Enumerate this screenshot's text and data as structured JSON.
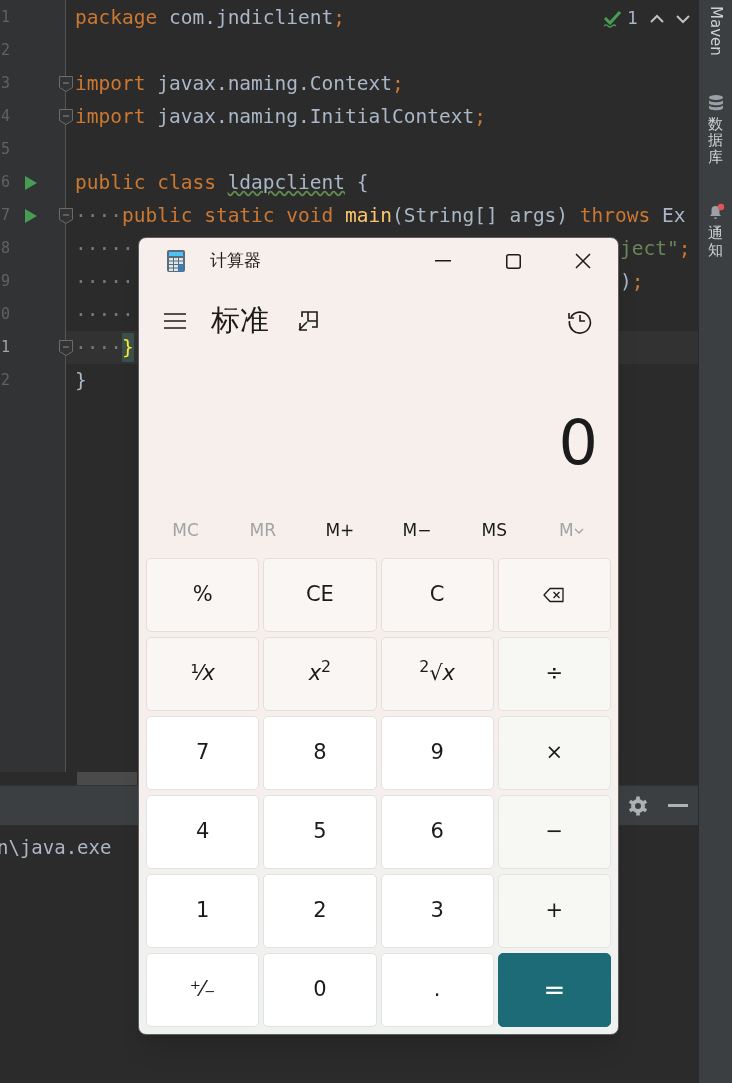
{
  "editor": {
    "lines": [
      {
        "number": "1",
        "current": false,
        "run": false,
        "fold": false,
        "tokens": [
          {
            "kind": "keyword",
            "text": "package"
          },
          {
            "kind": "plain",
            "text": " com.jndiclient"
          },
          {
            "kind": "keyword",
            "text": ";"
          }
        ]
      },
      {
        "number": "2",
        "current": false,
        "run": false,
        "fold": false
      },
      {
        "number": "3",
        "current": false,
        "run": false,
        "fold": true,
        "tokens": [
          {
            "kind": "keyword",
            "text": "import"
          },
          {
            "kind": "plain",
            "text": " javax.naming.Context"
          },
          {
            "kind": "keyword",
            "text": ";"
          }
        ]
      },
      {
        "number": "4",
        "current": false,
        "run": false,
        "fold": true,
        "tokens": [
          {
            "kind": "keyword",
            "text": "import"
          },
          {
            "kind": "plain",
            "text": " javax.naming.InitialContext"
          },
          {
            "kind": "keyword",
            "text": ";"
          }
        ]
      },
      {
        "number": "5",
        "current": false,
        "run": false,
        "fold": false
      },
      {
        "number": "6",
        "current": false,
        "run": true,
        "fold": false,
        "tokens": [
          {
            "kind": "keyword",
            "text": "public class "
          },
          {
            "kind": "warn",
            "text": "ldapclient"
          },
          {
            "kind": "plain",
            "text": " {"
          }
        ]
      },
      {
        "number": "7",
        "current": false,
        "run": true,
        "fold": true,
        "tokens": [
          {
            "kind": "ws",
            "text": "····"
          },
          {
            "kind": "keyword",
            "text": "public static void "
          },
          {
            "kind": "method",
            "text": "main"
          },
          {
            "kind": "plain",
            "text": "(String[] args) "
          },
          {
            "kind": "keyword",
            "text": "throws "
          },
          {
            "kind": "plain",
            "text": "Ex"
          }
        ]
      },
      {
        "number": "8",
        "current": false,
        "run": false,
        "fold": false,
        "tokens": [
          {
            "kind": "ws",
            "text": "·····"
          }
        ],
        "right": [
          {
            "kind": "string",
            "text": "ject\""
          },
          {
            "kind": "keyword",
            "text": ";"
          }
        ]
      },
      {
        "number": "9",
        "current": false,
        "run": false,
        "fold": false,
        "tokens": [
          {
            "kind": "ws",
            "text": "·····"
          }
        ],
        "right": [
          {
            "kind": "plain",
            "text": ")"
          },
          {
            "kind": "keyword",
            "text": ";"
          }
        ]
      },
      {
        "number": "0",
        "current": false,
        "run": false,
        "fold": false,
        "tokens": [
          {
            "kind": "ws",
            "text": "·····"
          }
        ]
      },
      {
        "number": "1",
        "current": true,
        "run": false,
        "fold": true,
        "tokens": [
          {
            "kind": "ws",
            "text": "····"
          },
          {
            "kind": "brace",
            "text": "}"
          }
        ]
      },
      {
        "number": "2",
        "current": false,
        "run": false,
        "fold": false,
        "tokens": [
          {
            "kind": "plain",
            "text": "}"
          }
        ]
      }
    ],
    "inspection_count": "1"
  },
  "sidebar": [
    {
      "kind": "rotated",
      "label": "Maven"
    },
    {
      "kind": "database",
      "label": "数据库"
    },
    {
      "kind": "bell",
      "label": "通知",
      "badge": true
    }
  ],
  "console": {
    "text": "n\\java.exe"
  },
  "calculator": {
    "title": "计算器",
    "mode": "标准",
    "display": "0",
    "memory": [
      {
        "label": "MC",
        "disabled": true,
        "dropdown": false
      },
      {
        "label": "MR",
        "disabled": true,
        "dropdown": false
      },
      {
        "label": "M+",
        "disabled": false,
        "dropdown": false
      },
      {
        "label": "M−",
        "disabled": false,
        "dropdown": false
      },
      {
        "label": "MS",
        "disabled": false,
        "dropdown": false
      },
      {
        "label": "M",
        "disabled": true,
        "dropdown": true
      }
    ],
    "keys": [
      {
        "kind": "function",
        "label": "%"
      },
      {
        "kind": "function",
        "label": "CE"
      },
      {
        "kind": "function",
        "label": "C"
      },
      {
        "kind": "backspace"
      },
      {
        "kind": "function",
        "label": "¹⁄*x*"
      },
      {
        "kind": "function",
        "label": "*x*$^{2}$"
      },
      {
        "kind": "function",
        "label": "$^{2}$√*x*"
      },
      {
        "kind": "operator",
        "label": "÷"
      },
      {
        "kind": "number",
        "label": "7"
      },
      {
        "kind": "number",
        "label": "8"
      },
      {
        "kind": "number",
        "label": "9"
      },
      {
        "kind": "operator",
        "label": "×"
      },
      {
        "kind": "number",
        "label": "4"
      },
      {
        "kind": "number",
        "label": "5"
      },
      {
        "kind": "number",
        "label": "6"
      },
      {
        "kind": "operator",
        "label": "−"
      },
      {
        "kind": "number",
        "label": "1"
      },
      {
        "kind": "number",
        "label": "2"
      },
      {
        "kind": "number",
        "label": "3"
      },
      {
        "kind": "operator",
        "label": "+"
      },
      {
        "kind": "number",
        "label": "⁺⁄₋"
      },
      {
        "kind": "number",
        "label": "0"
      },
      {
        "kind": "number",
        "label": "."
      },
      {
        "kind": "equals",
        "label": "="
      }
    ]
  }
}
